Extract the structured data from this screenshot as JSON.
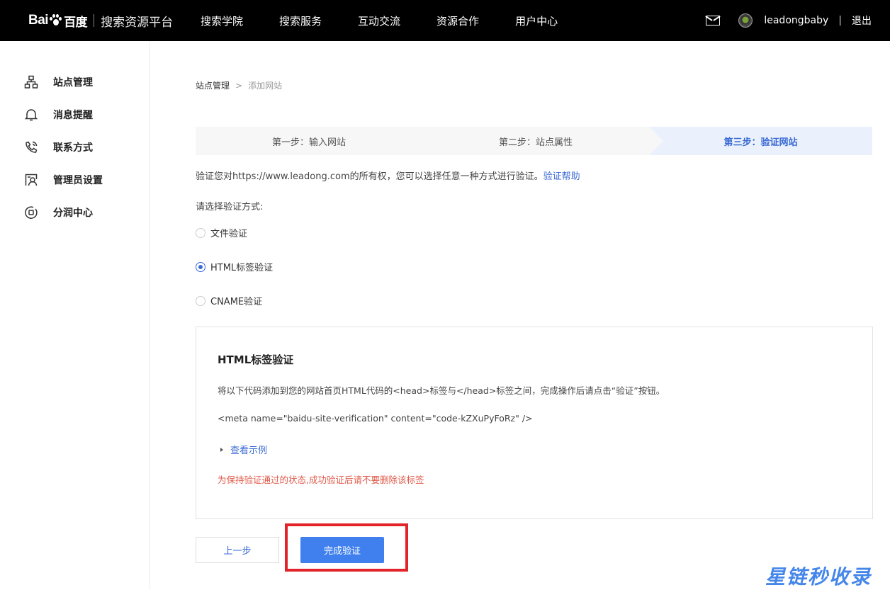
{
  "header": {
    "logo_text": "Bai",
    "logo_text2": "百度",
    "platform_name": "搜索资源平台",
    "nav": [
      "搜索学院",
      "搜索服务",
      "互动交流",
      "资源合作",
      "用户中心"
    ],
    "username": "leadongbaby",
    "separator": "|",
    "logout": "退出"
  },
  "sidebar": {
    "items": [
      {
        "label": "站点管理",
        "icon": "site-tree-icon"
      },
      {
        "label": "消息提醒",
        "icon": "bell-icon"
      },
      {
        "label": "联系方式",
        "icon": "phone-icon"
      },
      {
        "label": "管理员设置",
        "icon": "admin-user-icon"
      },
      {
        "label": "分润中心",
        "icon": "coin-icon"
      }
    ]
  },
  "breadcrumb": {
    "root": "站点管理",
    "sep": ">",
    "current": "添加网站"
  },
  "steps": [
    {
      "label": "第一步：输入网站",
      "active": false
    },
    {
      "label": "第二步：站点属性",
      "active": false
    },
    {
      "label": "第三步：验证网站",
      "active": true
    }
  ],
  "description": {
    "text": "验证您对https://www.leadong.com的所有权，您可以选择任意一种方式进行验证。",
    "help_link": "验证帮助"
  },
  "choose_label": "请选择验证方式:",
  "options": [
    {
      "label": "文件验证",
      "checked": false
    },
    {
      "label": "HTML标签验证",
      "checked": true
    },
    {
      "label": "CNAME验证",
      "checked": false
    }
  ],
  "panel": {
    "title": "HTML标签验证",
    "instruction": "将以下代码添加到您的网站首页HTML代码的<head>标签与</head>标签之间，完成操作后请点击“验证”按钮。",
    "code": "<meta name=\"baidu-site-verification\" content=\"code-kZXuPyFoRz\" />",
    "example_link": "查看示例",
    "warning": "为保持验证通过的状态,成功验证后请不要删除该标签"
  },
  "buttons": {
    "prev": "上一步",
    "done": "完成验证"
  },
  "watermark": "星链秒收录",
  "colors": {
    "accent": "#3a6ad4",
    "primary_button": "#4080ee",
    "warning": "#e05a4a",
    "highlight": "#e2232a"
  }
}
